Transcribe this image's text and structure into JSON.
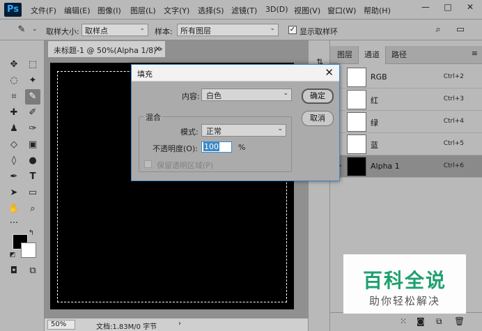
{
  "app": {
    "logo": "Ps",
    "menu": [
      "文件(F)",
      "编辑(E)",
      "图像(I)",
      "图层(L)",
      "文字(Y)",
      "选择(S)",
      "滤镜(T)",
      "3D(D)",
      "视图(V)",
      "窗口(W)",
      "帮助(H)"
    ],
    "window_controls": {
      "minimize": "—",
      "maximize": "□",
      "close": "✕"
    }
  },
  "options_bar": {
    "sample_size_label": "取样大小:",
    "sample_size_value": "取样点",
    "sample_label": "样本:",
    "sample_value": "所有图层",
    "show_ring_label": "显示取样环",
    "show_ring_checked": true
  },
  "document": {
    "tab_title": "未标题-1 @ 50%(Alpha 1/8) *",
    "zoom": "50%",
    "doc_info": "文档:1.83M/0 字节"
  },
  "channels_panel": {
    "tabs": [
      "图层",
      "通道",
      "路径"
    ],
    "active_tab": "通道",
    "channels": [
      {
        "name": "RGB",
        "shortcut": "Ctrl+2"
      },
      {
        "name": "红",
        "shortcut": "Ctrl+3"
      },
      {
        "name": "绿",
        "shortcut": "Ctrl+4"
      },
      {
        "name": "蓝",
        "shortcut": "Ctrl+5"
      },
      {
        "name": "Alpha 1",
        "shortcut": "Ctrl+6"
      }
    ]
  },
  "fill_dialog": {
    "title": "填充",
    "content_label": "内容:",
    "content_value": "白色",
    "blend_group_label": "混合",
    "mode_label": "模式:",
    "mode_value": "正常",
    "opacity_label": "不透明度(O):",
    "opacity_value": "100",
    "opacity_unit": "%",
    "preserve_label": "保留透明区域(P)",
    "ok_label": "确定",
    "cancel_label": "取消"
  },
  "watermark": {
    "title": "百科全说",
    "subtitle": "助你轻松解决"
  }
}
